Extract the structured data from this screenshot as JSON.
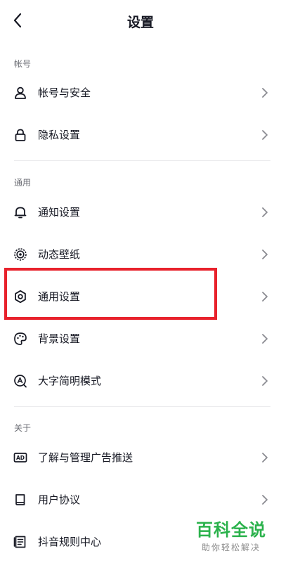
{
  "header": {
    "title": "设置"
  },
  "sections": [
    {
      "label": "帐号",
      "items": [
        {
          "label": "帐号与安全",
          "icon": "user-icon"
        },
        {
          "label": "隐私设置",
          "icon": "lock-icon"
        }
      ]
    },
    {
      "label": "通用",
      "items": [
        {
          "label": "通知设置",
          "icon": "bell-icon"
        },
        {
          "label": "动态壁纸",
          "icon": "live-wallpaper-icon"
        },
        {
          "label": "通用设置",
          "icon": "gear-icon"
        },
        {
          "label": "背景设置",
          "icon": "palette-icon"
        },
        {
          "label": "大字简明模式",
          "icon": "large-text-icon"
        }
      ]
    },
    {
      "label": "关于",
      "items": [
        {
          "label": "了解与管理广告推送",
          "icon": "ad-icon"
        },
        {
          "label": "用户协议",
          "icon": "book-icon"
        },
        {
          "label": "抖音规则中心",
          "icon": "rules-icon"
        }
      ]
    }
  ],
  "watermark": {
    "main": "百科全说",
    "sub": "助你轻松解决"
  },
  "colors": {
    "highlight": "#e8222c",
    "watermark": "#2bb24c"
  }
}
